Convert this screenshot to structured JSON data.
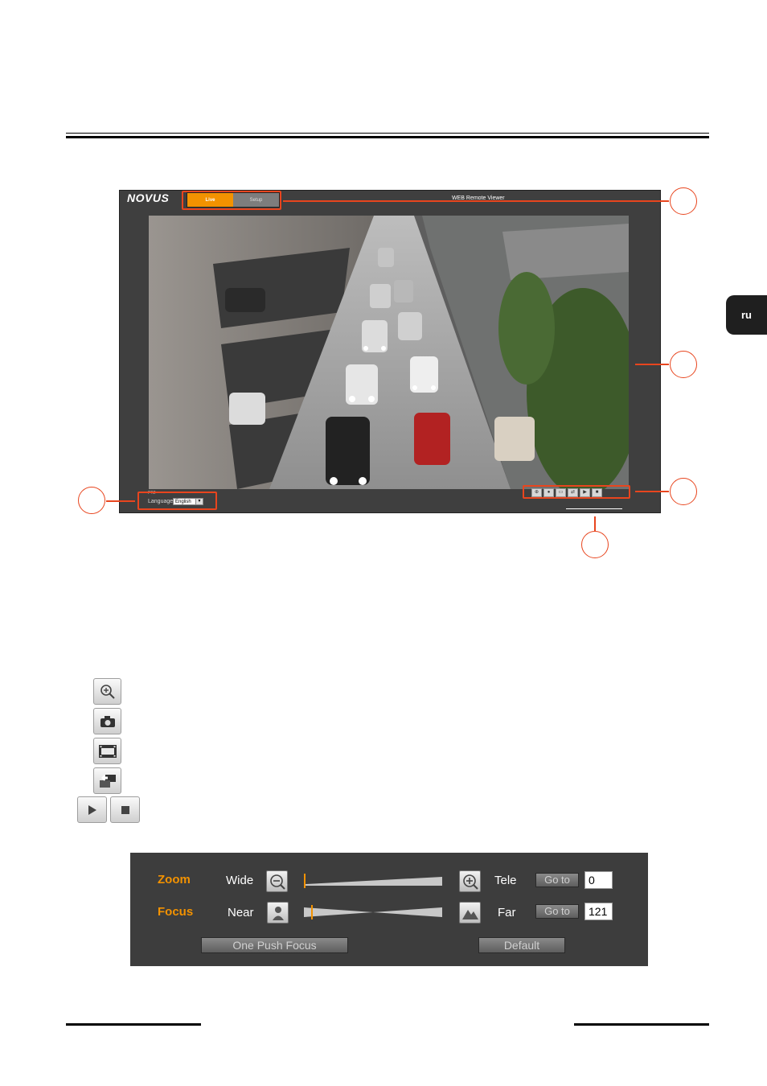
{
  "side_tab": {
    "label": "ru"
  },
  "viewer": {
    "logo": "NOVUS",
    "tabs": [
      {
        "label": "Live"
      },
      {
        "label": "Setup"
      }
    ],
    "title": "WEB Remote Viewer",
    "ptz_link": "PTZ",
    "language_label": "Language",
    "language_value": "English"
  },
  "panel": {
    "zoom": {
      "label": "Zoom",
      "min_label": "Wide",
      "max_label": "Tele",
      "goto_label": "Go to",
      "value": "0",
      "position": 0.0
    },
    "focus": {
      "label": "Focus",
      "min_label": "Near",
      "max_label": "Far",
      "goto_label": "Go to",
      "value": "121",
      "position": 0.05
    },
    "one_push_focus": "One Push Focus",
    "default": "Default"
  },
  "icons": [
    "zoom-in-icon",
    "camera-icon",
    "film-icon",
    "swap-screen-icon",
    "play-icon",
    "stop-icon"
  ],
  "colors": {
    "accent": "#f39200",
    "callout": "#e8451e",
    "panel_bg": "#3d3d3d"
  }
}
